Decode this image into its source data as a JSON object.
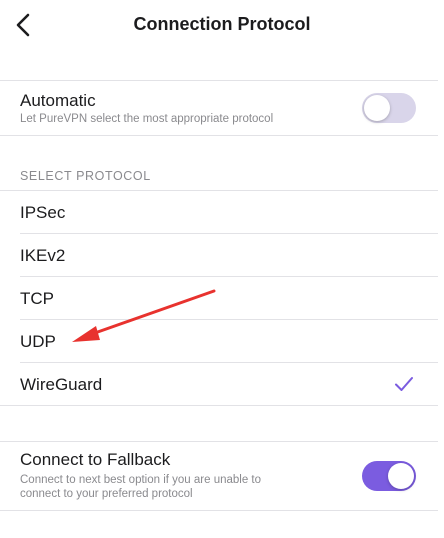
{
  "header": {
    "title": "Connection Protocol",
    "back_icon": "chevron-left-icon"
  },
  "automatic": {
    "title": "Automatic",
    "subtitle": "Let PureVPN select the most appropriate protocol",
    "enabled": false
  },
  "protocol_section": {
    "header": "SELECT PROTOCOL",
    "items": [
      {
        "label": "IPSec",
        "selected": false
      },
      {
        "label": "IKEv2",
        "selected": false
      },
      {
        "label": "TCP",
        "selected": false
      },
      {
        "label": "UDP",
        "selected": false
      },
      {
        "label": "WireGuard",
        "selected": true
      }
    ],
    "check_icon": "checkmark-icon"
  },
  "fallback": {
    "title": "Connect to Fallback",
    "subtitle_line1": "Connect to next best option if you are unable to",
    "subtitle_line2": "connect to your preferred protocol",
    "enabled": true
  },
  "colors": {
    "accent": "#7b5ce0",
    "toggle_off": "#d9d5ea",
    "annotation_arrow": "#e8322e",
    "divider": "#e2e2e6",
    "secondary_text": "#8a8a8e"
  }
}
